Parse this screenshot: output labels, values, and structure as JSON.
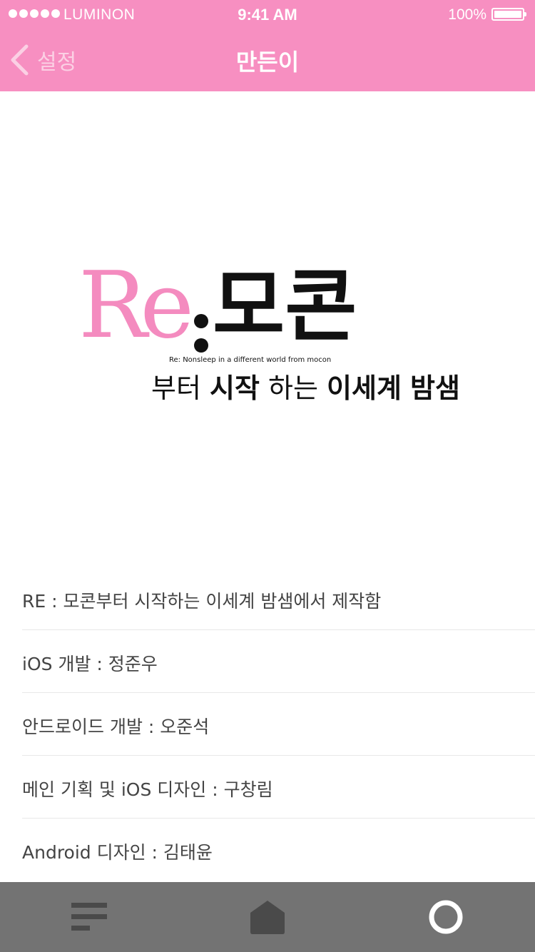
{
  "status_bar": {
    "carrier": "LUMINON",
    "time": "9:41 AM",
    "battery": "100%",
    "battery_level": 1.0,
    "signal_bars": 5
  },
  "nav": {
    "back_label": "설정",
    "title": "만든이"
  },
  "logo": {
    "prefix": "Re",
    "main": "모콘",
    "tagline": "Re: Nonsleep in a different world from mocon",
    "subtitle_parts": [
      "부터",
      "시작",
      "하는",
      "이세계",
      "밤샘"
    ]
  },
  "credits": [
    "RE : 모콘부터 시작하는 이세계 밤샘에서 제작함",
    "iOS 개발 : 정준우",
    "안드로이드 개발 : 오준석",
    "메인 기획 및 iOS 디자인 : 구창림",
    "Android 디자인 : 김태윤"
  ],
  "tab_bar": {
    "tabs": [
      {
        "icon": "menu-lines-icon",
        "selected": false
      },
      {
        "icon": "home-icon",
        "selected": false
      },
      {
        "icon": "circle-icon",
        "selected": true
      }
    ]
  },
  "colors": {
    "accent": "#f78fc1",
    "logo_pink": "#f48bbf",
    "tab_bar": "#737373",
    "tab_icon": "#4a4a4a",
    "tab_icon_selected": "#ffffff"
  }
}
